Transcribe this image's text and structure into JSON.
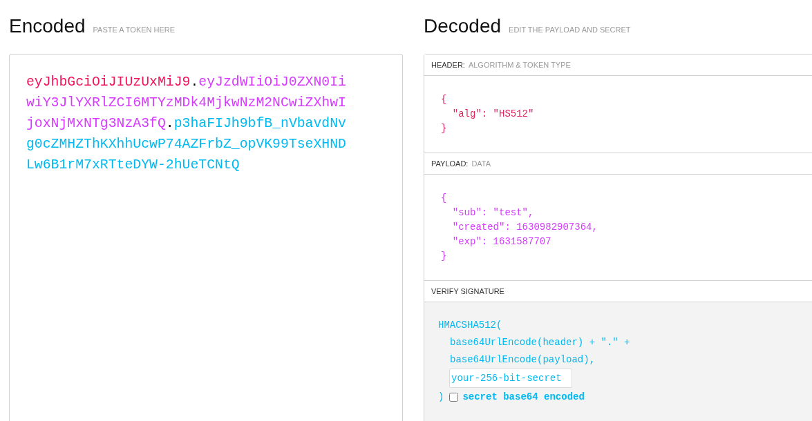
{
  "encoded": {
    "title": "Encoded",
    "hint": "PASTE A TOKEN HERE",
    "token": [
      {
        "text": "eyJhbGciOiJIUzUxMiJ9",
        "color": "#f0145a"
      },
      {
        "text": ".",
        "color": "#000000"
      },
      {
        "text": "eyJzdWIiOiJ0ZXN0IiwiY3JlYXRlZCI6MTYzMDk4MjkwNzM2NCwiZXhwIjoxNjMxNTg3NzA3fQ",
        "color": "#d63aff"
      },
      {
        "text": ".",
        "color": "#000000"
      },
      {
        "text": "p3haFIJh9bfB_nVbavdNvg0cZMHZThKXhhUcwP74AZFrbZ_opVK99TseXHNDLw6B1rM7xRTteDYW-2hUeTCNtQ",
        "color": "#00b9f1"
      }
    ]
  },
  "decoded": {
    "title": "Decoded",
    "hint": "EDIT THE PAYLOAD AND SECRET",
    "sections": [
      {
        "kind": "json",
        "label": "HEADER:",
        "hint": "ALGORITHM & TOKEN TYPE",
        "color": "#e0245e",
        "code": "{\n  \"alg\": \"HS512\"\n}"
      },
      {
        "kind": "json",
        "label": "PAYLOAD:",
        "hint": "DATA",
        "color": "#d63aff",
        "code": "{\n  \"sub\": \"test\",\n  \"created\": 1630982907364,\n  \"exp\": 1631587707\n}"
      },
      {
        "kind": "signature",
        "label": "VERIFY SIGNATURE",
        "color": "#00b9f1",
        "opening": "HMACSHA512(",
        "lines": [
          "base64UrlEncode(header) + \".\" +",
          "base64UrlEncode(payload),"
        ],
        "secret": {
          "value": "your-256-bit-secret"
        },
        "closing": ")",
        "checkbox": {
          "label": "secret base64 encoded",
          "checked": false
        }
      }
    ]
  }
}
